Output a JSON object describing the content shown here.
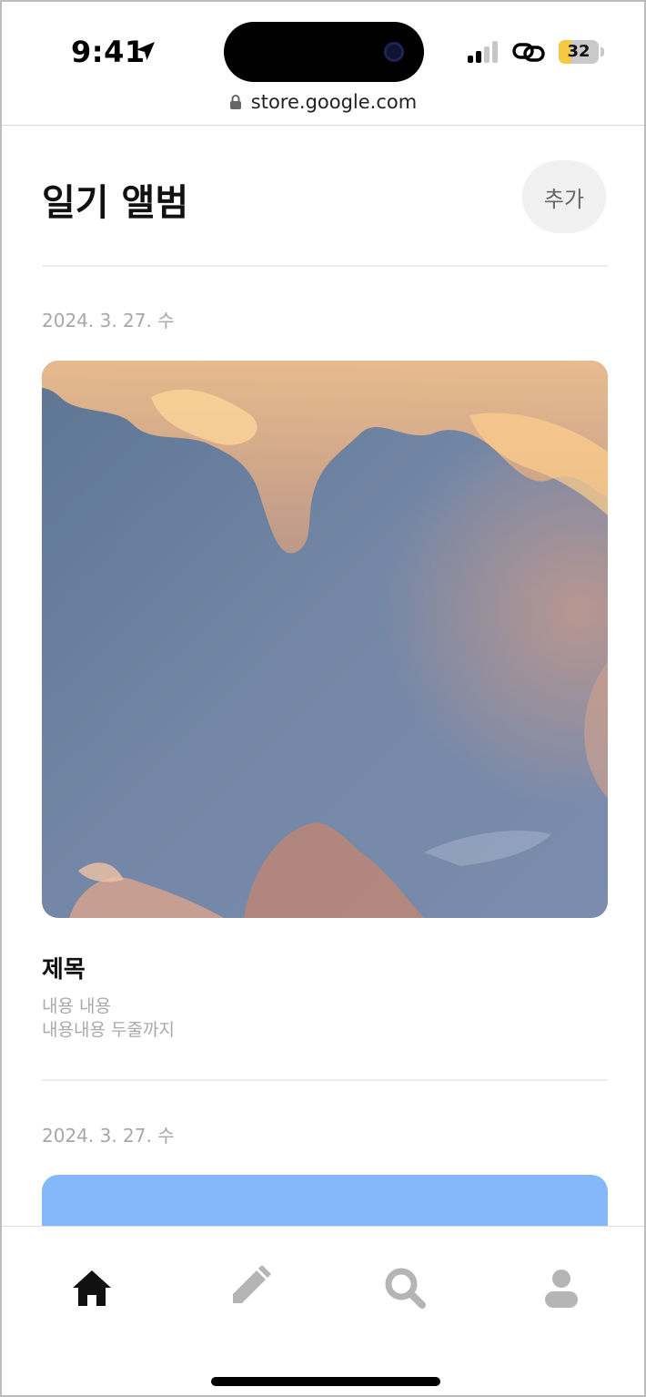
{
  "status_bar": {
    "time": "9:41",
    "battery": "32",
    "battery_level": 0.32,
    "url": "store.google.com"
  },
  "header": {
    "title": "일기 앨범",
    "add_label": "추가"
  },
  "entries": [
    {
      "date": "2024. 3. 27. 수",
      "title": "제목",
      "body_line1": "내용 내용",
      "body_line2": "내용내용 두줄까지"
    },
    {
      "date": "2024. 3. 27. 수"
    }
  ],
  "colors": {
    "accent_battery": "#f6c944",
    "second_photo": "#84b8fb",
    "active_tab": "#111111",
    "inactive_tab": "#b5b5b5"
  },
  "nav": {
    "tabs": [
      {
        "icon": "home-icon",
        "active": true
      },
      {
        "icon": "pencil-icon",
        "active": false
      },
      {
        "icon": "search-icon",
        "active": false
      },
      {
        "icon": "profile-icon",
        "active": false
      }
    ]
  }
}
